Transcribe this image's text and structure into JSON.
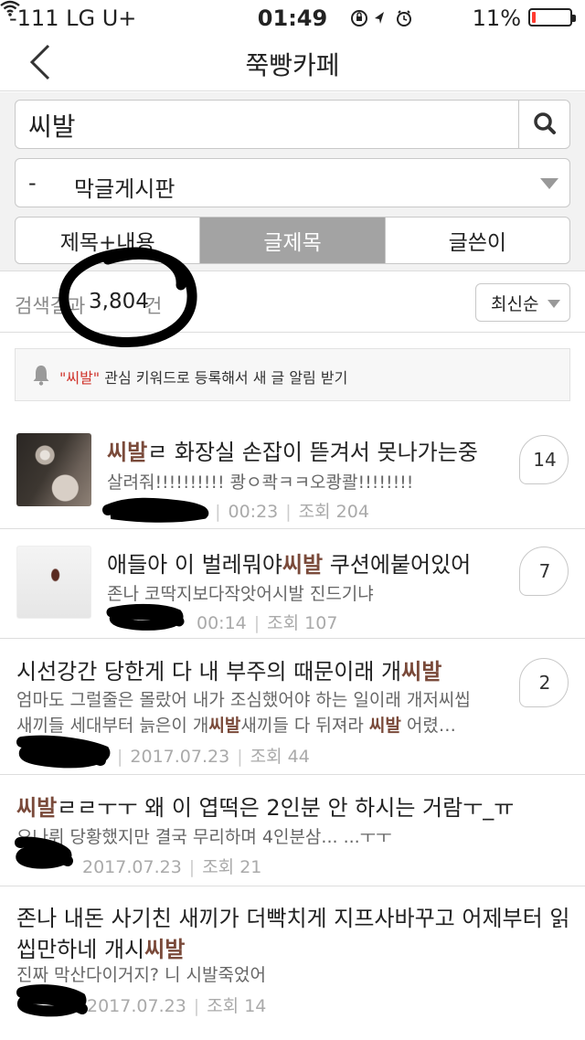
{
  "status_bar": {
    "carrier": "-111 LG U+",
    "time": "01:49",
    "battery_percent": "11%",
    "battery_level": 0.11,
    "battery_color": "#ff3b30"
  },
  "nav": {
    "back_icon": "chevron-left-icon",
    "title": "쭉빵카페"
  },
  "search": {
    "query": "씨발",
    "search_icon": "magnifier-icon",
    "board_prefix": "-",
    "board_name": "막글게시판",
    "tabs": [
      "제목+내용",
      "글제목",
      "글쓴이"
    ],
    "active_tab": "글제목"
  },
  "results": {
    "label": "검색결과",
    "count": "3,804",
    "unit": "건",
    "sort": "최신순"
  },
  "alert": {
    "keyword": "\"씨발\"",
    "text": " 관심 키워드로 등록해서 새 글 알림 받기"
  },
  "posts": [
    {
      "title_hl": "씨발",
      "title_rest": "ㄹ 화장실 손잡이 뜯겨서 못나가는중",
      "desc": "살려줘!!!!!!!!!! 쾅ㅇ콱ㅋㅋ오쾅콸!!!!!!!!",
      "author": "..",
      "date": "00:23",
      "views": "조회 204",
      "comments": "14"
    },
    {
      "title_pre": "애들아 이 벌레뭐야",
      "title_hl": "씨발",
      "title_rest": " 쿠션에붙어있어",
      "desc": "존나 코딱지보다작앗어시발 진드기냐",
      "date": "00:14",
      "views": "조회 107",
      "comments": "7"
    },
    {
      "title_pre": "시선강간 당한게 다 내 부주의 때문이래 개",
      "title_hl": "씨발",
      "desc1": "엄마도 그럴줄은 몰랐어 내가 조심했어야 하는 일이래 개저씨씹",
      "desc2_pre": "새끼들 세대부터 늙은이 개",
      "desc2_hl": "씨발",
      "desc2_mid": "새끼들 다 뒤져라 ",
      "desc2_hl2": "씨발",
      "desc2_rest": " 어렸…",
      "date": "2017.07.23",
      "views": "조회 44",
      "comments": "2"
    },
    {
      "title_hl": "씨발",
      "title_rest": "ㄹㄹㅜㅜ 왜 이 엽떡은 2인분 안 하시는 거람ㅜ_ㅠ",
      "desc": "요나뤼 당황했지만 결국 무리하며 4인분삼... ...ㅜㅜ",
      "date": "2017.07.23",
      "views": "조회 21"
    },
    {
      "title1": "존나 내돈 사기친 새끼가 더빡치게 지프사바꾸고 어제부터 읽",
      "title2_pre": "씹만하네 개시",
      "title2_hl": "씨발",
      "desc": "진짜 막산다이거지? 니 시발죽었어",
      "date": "2017.07.23",
      "views": "조회 14"
    }
  ]
}
